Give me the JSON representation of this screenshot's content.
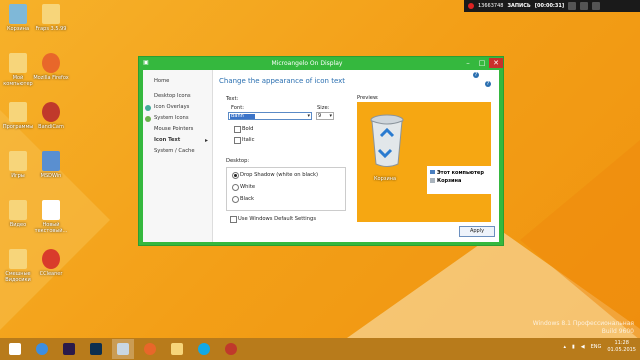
{
  "recorder": {
    "fps": "13663748",
    "status": "ЗАПИСЬ",
    "time": "[00:00:31]"
  },
  "desktop_icons": [
    {
      "label": "Корзина",
      "icon": "recycle-bin-icon",
      "color": "#7fb8d8"
    },
    {
      "label": "Fraps 3.5.99",
      "icon": "folder-icon",
      "color": "#f7d57a"
    },
    {
      "label": "Мой компьютер",
      "icon": "computer-icon",
      "color": "#f7d57a"
    },
    {
      "label": "Mozilla Firefox",
      "icon": "firefox-icon",
      "color": "#e8672a"
    },
    {
      "label": "Программы",
      "icon": "folder-icon",
      "color": "#f7d57a"
    },
    {
      "label": "BandiCam",
      "icon": "bandicam-icon",
      "color": "#c0392b"
    },
    {
      "label": "Игры",
      "icon": "folder-icon",
      "color": "#f7d57a"
    },
    {
      "label": "MSDWin",
      "icon": "monitor-icon",
      "color": "#5a8fd0"
    },
    {
      "label": "Видео",
      "icon": "folder-icon",
      "color": "#f7d57a"
    },
    {
      "label": "Новый текстовый...",
      "icon": "document-icon",
      "color": "#ffffff"
    },
    {
      "label": "Смешные Видосики",
      "icon": "folder-icon",
      "color": "#f7d57a"
    },
    {
      "label": "CCleaner",
      "icon": "ccleaner-icon",
      "color": "#d93b2b"
    }
  ],
  "window": {
    "title": "Microangelo On Display",
    "controls": [
      "–",
      "□",
      "✕"
    ]
  },
  "sidebar": {
    "items": [
      {
        "label": "Home",
        "icon": ""
      },
      {
        "label": "Desktop Icons",
        "icon": ""
      },
      {
        "label": "Icon Overlays",
        "icon": "overlay-icon"
      },
      {
        "label": "System Icons",
        "icon": "system-icon"
      },
      {
        "label": "Mouse Pointers",
        "icon": ""
      },
      {
        "label": "Icon Text",
        "icon": "",
        "active": true,
        "arrow": "▸"
      },
      {
        "label": "System / Cache",
        "icon": ""
      }
    ]
  },
  "main": {
    "heading": "Change the appearance of icon text",
    "text_label": "Text:",
    "font_label": "Font:",
    "font_value": "Bahn",
    "size_label": "Size:",
    "size_value": "9",
    "bold_label": "Bold",
    "italic_label": "Italic",
    "desktop_label": "Desktop:",
    "radios": [
      {
        "label": "Drop Shadow (white on black)",
        "checked": true
      },
      {
        "label": "White",
        "checked": false
      },
      {
        "label": "Black",
        "checked": false
      }
    ],
    "default_settings_label": "Use Windows Default Settings",
    "preview_label": "Preview:",
    "preview_bin_label": "Корзина",
    "preview_list": [
      "Этот компьютер",
      "Корзина"
    ],
    "apply_label": "Apply",
    "help": "?"
  },
  "taskbar": {
    "apps": [
      {
        "name": "windows-start-icon",
        "color": "#ffffff"
      },
      {
        "name": "ie-icon",
        "color": "#3d8ee0"
      },
      {
        "name": "premiere-icon",
        "color": "#2b1a4a"
      },
      {
        "name": "photoshop-icon",
        "color": "#0d2f4f"
      },
      {
        "name": "microangelo-icon",
        "color": "#c9d7e3"
      },
      {
        "name": "firefox-icon",
        "color": "#e8672a"
      },
      {
        "name": "folder-icon",
        "color": "#f7d57a"
      },
      {
        "name": "skype-icon",
        "color": "#12a9e6"
      },
      {
        "name": "bandicam-icon",
        "color": "#c0392b"
      }
    ],
    "lang": "ENG",
    "time": "11:28",
    "date": "01.05.2015"
  },
  "watermark": {
    "line1": "Windows 8.1 Профессиональная",
    "line2": "Build 9600"
  }
}
